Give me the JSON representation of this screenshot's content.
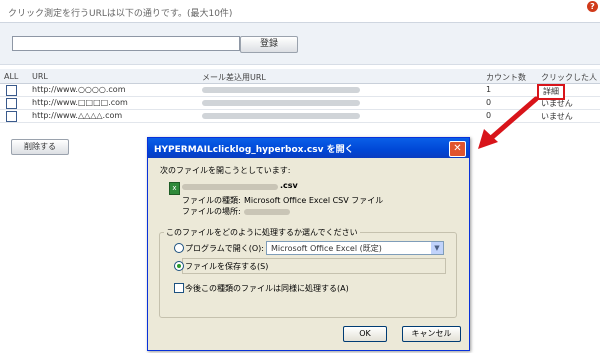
{
  "header": {
    "text": "クリック測定を行うURLは以下の通りです。(最大10件)",
    "help_icon": "?"
  },
  "form": {
    "input_value": "",
    "register_label": "登録"
  },
  "table": {
    "columns": [
      "ALL",
      "URL",
      "メール差込用URL",
      "カウント数",
      "クリックした人"
    ],
    "rows": [
      {
        "url": "http://www.○○○○.com",
        "count": "1",
        "clicked": "詳細"
      },
      {
        "url": "http://www.□□□□.com",
        "count": "0",
        "clicked": "いません"
      },
      {
        "url": "http://www.△△△△.com",
        "count": "0",
        "clicked": "いません"
      }
    ]
  },
  "delete_label": "削除する",
  "dialog": {
    "title": "HYPERMAILclicklog_hyperbox.csv を開く",
    "close_icon": "✕",
    "prompt": "次のファイルを開こうとしています:",
    "file_ext": ".csv",
    "type_label": "ファイルの種類:",
    "type_value": "Microsoft Office Excel CSV ファイル",
    "location_label": "ファイルの場所:",
    "group_label": "このファイルをどのように処理するか選んでください",
    "open_with_label": "プログラムで開く(O):",
    "open_with_value": "Microsoft Office Excel (既定)",
    "save_label": "ファイルを保存する(S)",
    "always_label": "今後この種類のファイルは同様に処理する(A)",
    "ok_label": "OK",
    "cancel_label": "キャンセル"
  },
  "colors": {
    "accent_red": "#d8141a",
    "titlebar_blue": "#0a5fe8"
  }
}
